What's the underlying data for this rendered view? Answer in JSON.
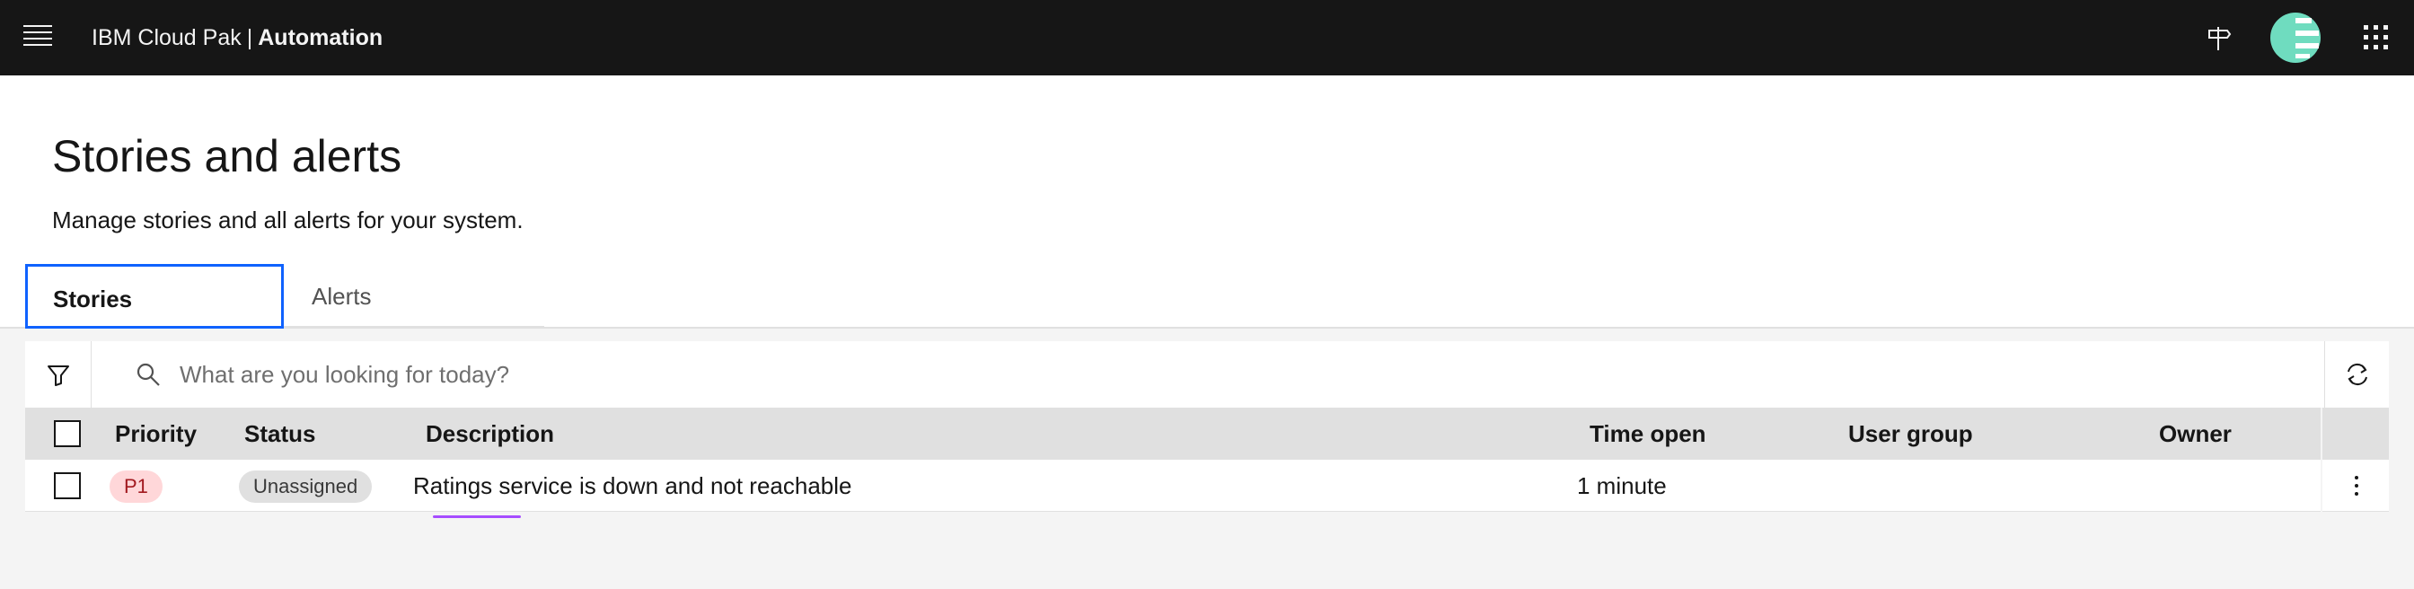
{
  "header": {
    "menu_icon": "hamburger-menu-icon",
    "brand_name": "IBM Cloud Pak",
    "brand_separator": "|",
    "product_name": "Automation",
    "help_icon": "signpost-icon",
    "avatar_icon": "user-avatar-icon",
    "switcher_icon": "app-switcher-icon",
    "avatar_colors": {
      "primary": "#6fdcbf",
      "secondary": "#ffffff"
    }
  },
  "page": {
    "title": "Stories and alerts",
    "subtitle": "Manage stories and all alerts for your system."
  },
  "tabs": [
    {
      "label": "Stories",
      "selected": true
    },
    {
      "label": "Alerts",
      "selected": false
    }
  ],
  "toolbar": {
    "filter_icon": "filter-icon",
    "search_icon": "search-icon",
    "search_value": "",
    "search_placeholder": "What are you looking for today?",
    "refresh_icon": "refresh-icon"
  },
  "table": {
    "columns": [
      "Priority",
      "Status",
      "Description",
      "Time open",
      "User group",
      "Owner"
    ],
    "rows": [
      {
        "priority": "P1",
        "status": "Unassigned",
        "description": "Ratings service is down and not reachable",
        "time_open": "1 minute",
        "user_group": "",
        "owner": ""
      }
    ]
  },
  "colors": {
    "accent": "#0f62fe",
    "header_bg": "#161616",
    "priority_tag_bg": "#ffd7d9",
    "priority_tag_text": "#a2191f",
    "status_tag_bg": "#e0e0e0",
    "annotation_underline": "#a64dff"
  }
}
